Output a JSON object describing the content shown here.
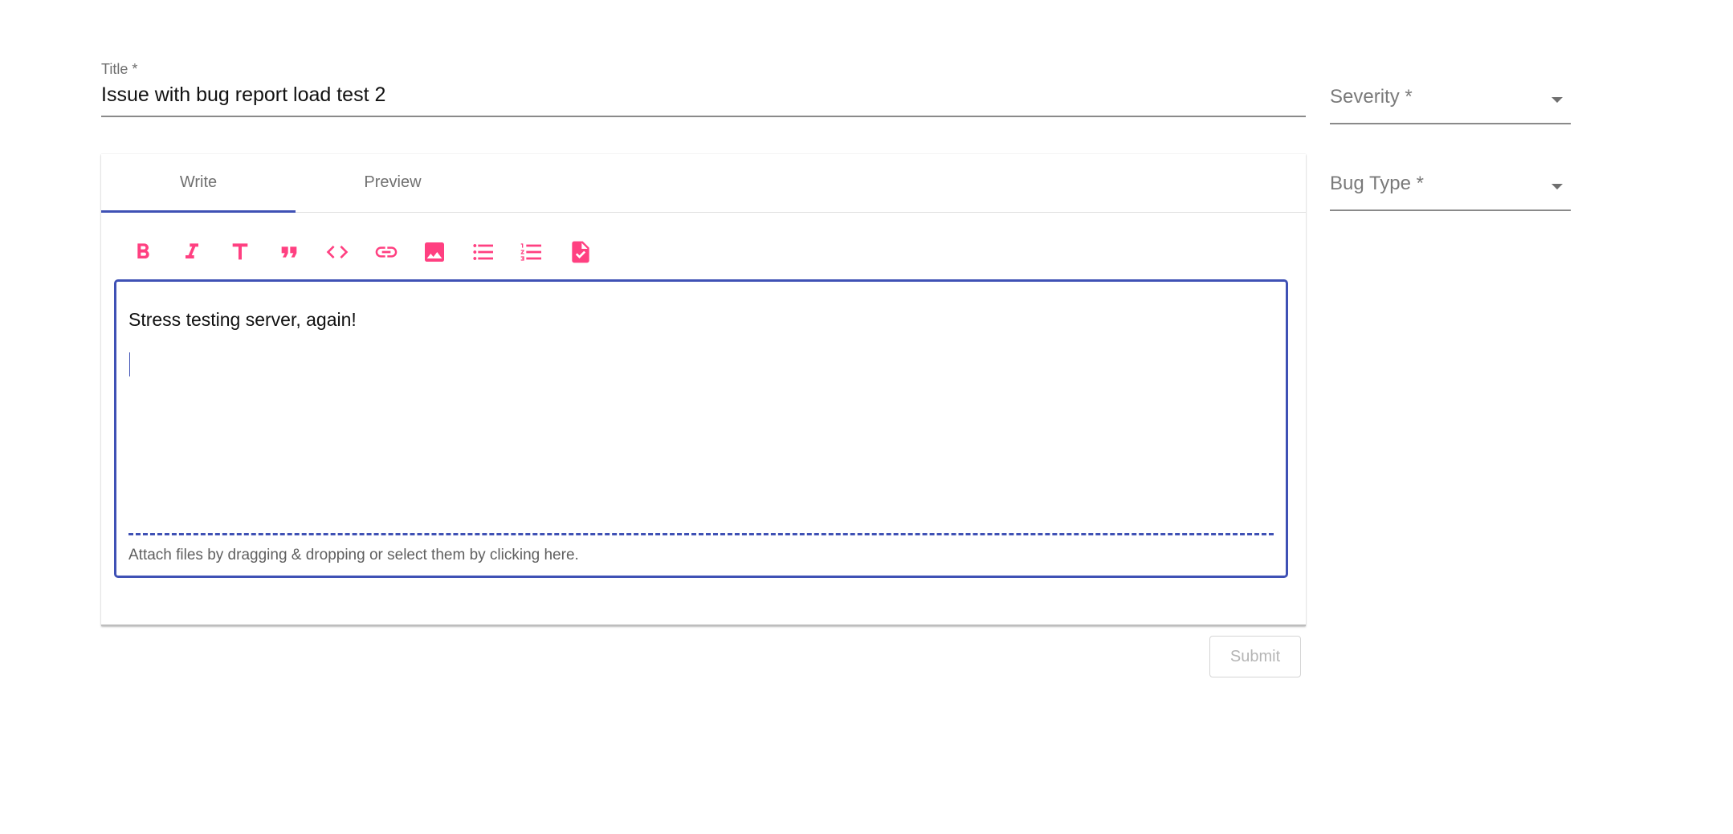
{
  "form": {
    "title_label": "Title *",
    "title_value": "Issue with bug report load test 2",
    "severity_label": "Severity *",
    "bug_type_label": "Bug Type *",
    "submit_label": "Submit"
  },
  "editor": {
    "tabs": [
      {
        "label": "Write",
        "active": true
      },
      {
        "label": "Preview",
        "active": false
      }
    ],
    "toolbar_icons": [
      "bold-icon",
      "italic-icon",
      "header-icon",
      "quote-icon",
      "code-icon",
      "link-icon",
      "image-icon",
      "unordered-list-icon",
      "ordered-list-icon",
      "checked-list-icon"
    ],
    "body_text": "Stress testing server, again!",
    "attach_hint": "Attach files by dragging & dropping or select them by clicking here."
  },
  "colors": {
    "accent": "#3f51b5",
    "toolbar_icon": "#ff4081",
    "muted_text": "#707070"
  }
}
